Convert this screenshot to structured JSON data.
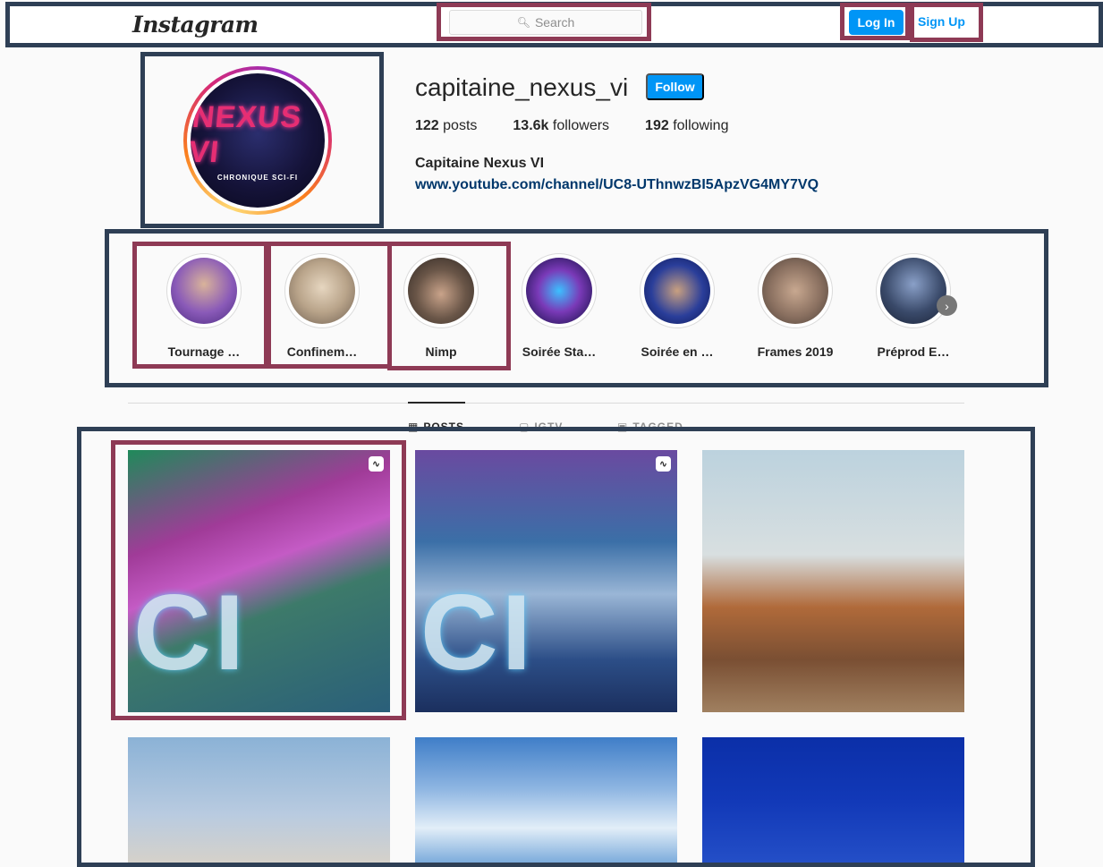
{
  "header": {
    "logo_text": "Instagram",
    "search_placeholder": "Search",
    "login_label": "Log In",
    "signup_label": "Sign Up"
  },
  "profile": {
    "username": "capitaine_nexus_vi",
    "follow_label": "Follow",
    "avatar_title": "NEXUS VI",
    "avatar_subtitle": "CHRONIQUE SCI-FI",
    "stats": [
      {
        "count": "122",
        "label": "posts"
      },
      {
        "count": "13.6k",
        "label": "followers"
      },
      {
        "count": "192",
        "label": "following"
      }
    ],
    "full_name": "Capitaine Nexus VI",
    "bio_link": "www.youtube.com/channel/UC8-UThnwzBI5ApzVG4MY7VQ"
  },
  "highlights": [
    {
      "label": "Tournage …",
      "color": "#6a3fa0"
    },
    {
      "label": "Confinem…",
      "color": "#b9a48a"
    },
    {
      "label": "Nimp",
      "color": "#5a4a40"
    },
    {
      "label": "Soirée Sta…",
      "color": "#1b2a8a"
    },
    {
      "label": "Soirée en …",
      "color": "#1a2f7a"
    },
    {
      "label": "Frames 2019",
      "color": "#8a7060"
    },
    {
      "label": "Préprod E…",
      "color": "#3a4a6a"
    }
  ],
  "tabs": [
    {
      "label": "POSTS",
      "icon": "grid-icon",
      "active": true
    },
    {
      "label": "IGTV",
      "icon": "igtv-icon",
      "active": false
    },
    {
      "label": "TAGGED",
      "icon": "tag-icon",
      "active": false
    }
  ],
  "posts": [
    {
      "overlay": "CI",
      "igtv": true
    },
    {
      "overlay": "CI",
      "igtv": true
    },
    {
      "overlay": "",
      "igtv": false
    },
    {
      "overlay": "",
      "igtv": false
    },
    {
      "overlay": "",
      "igtv": false
    },
    {
      "overlay": "",
      "igtv": false
    }
  ],
  "colors": {
    "accent": "#0095f6",
    "link": "#00376b",
    "frame_dark": "#2e3f55",
    "frame_red": "#8e3a55"
  }
}
